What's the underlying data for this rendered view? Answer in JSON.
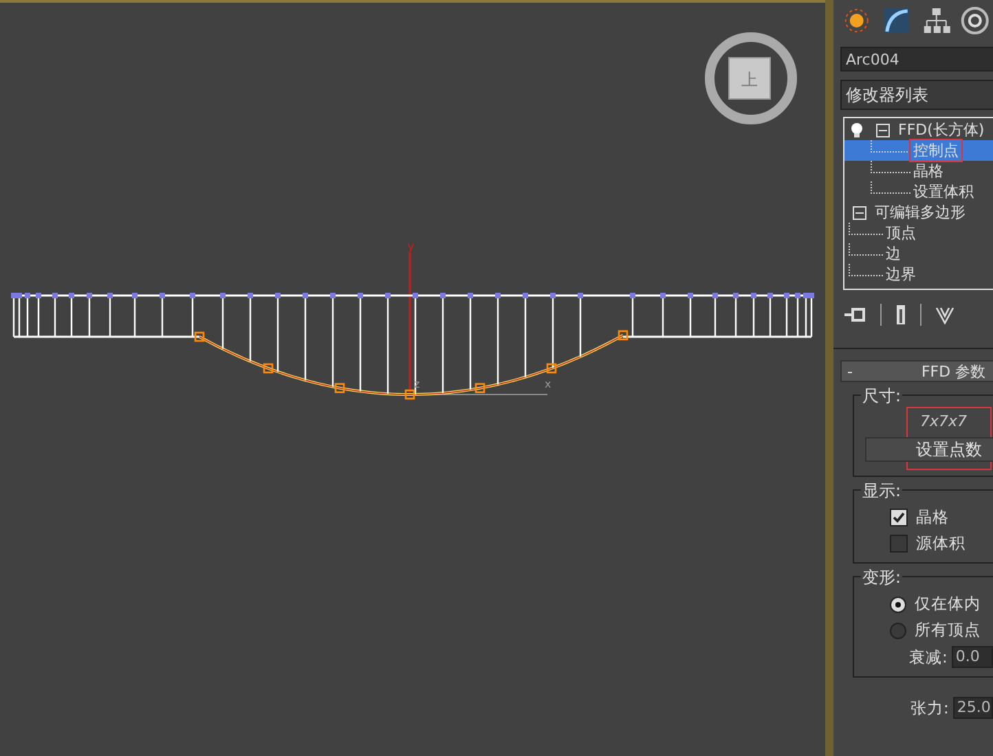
{
  "viewport": {
    "view_cube": {
      "face": "上"
    },
    "axis_labels": [
      "y",
      "z",
      "x"
    ]
  },
  "panel": {
    "object_name": "Arc004",
    "modifier_list": "修改器列表",
    "stack": [
      {
        "label": "FFD(长方体)",
        "expanded": true,
        "selected": false,
        "children": [
          {
            "label": "控制点",
            "selected": true,
            "highlighted": true
          },
          {
            "label": "晶格",
            "selected": false,
            "highlighted": false
          },
          {
            "label": "设置体积",
            "selected": false,
            "highlighted": false
          }
        ]
      },
      {
        "label": "可编辑多边形",
        "expanded": true,
        "selected": false,
        "children": [
          {
            "label": "顶点",
            "selected": false,
            "highlighted": false
          },
          {
            "label": "边",
            "selected": false,
            "highlighted": false
          },
          {
            "label": "边界",
            "selected": false,
            "highlighted": false
          }
        ]
      }
    ],
    "rollout": {
      "collapse": "-",
      "title": "FFD 参数",
      "groups": [
        {
          "kind": "dims",
          "title": "尺寸:",
          "value": "7x7x7",
          "button": "设置点数",
          "highlighted": true
        },
        {
          "kind": "checks",
          "title": "显示:",
          "items": [
            {
              "label": "晶格",
              "checked": true
            },
            {
              "label": "源体积",
              "checked": false
            }
          ]
        },
        {
          "kind": "radios",
          "title": "变形:",
          "items": [
            {
              "label": "仅在体内",
              "selected": true
            },
            {
              "label": "所有顶点",
              "selected": false
            }
          ],
          "field": {
            "label": "衰减:",
            "value": "0.0"
          }
        }
      ],
      "fields": [
        {
          "label": "张力:",
          "value": "25.0"
        }
      ]
    }
  }
}
